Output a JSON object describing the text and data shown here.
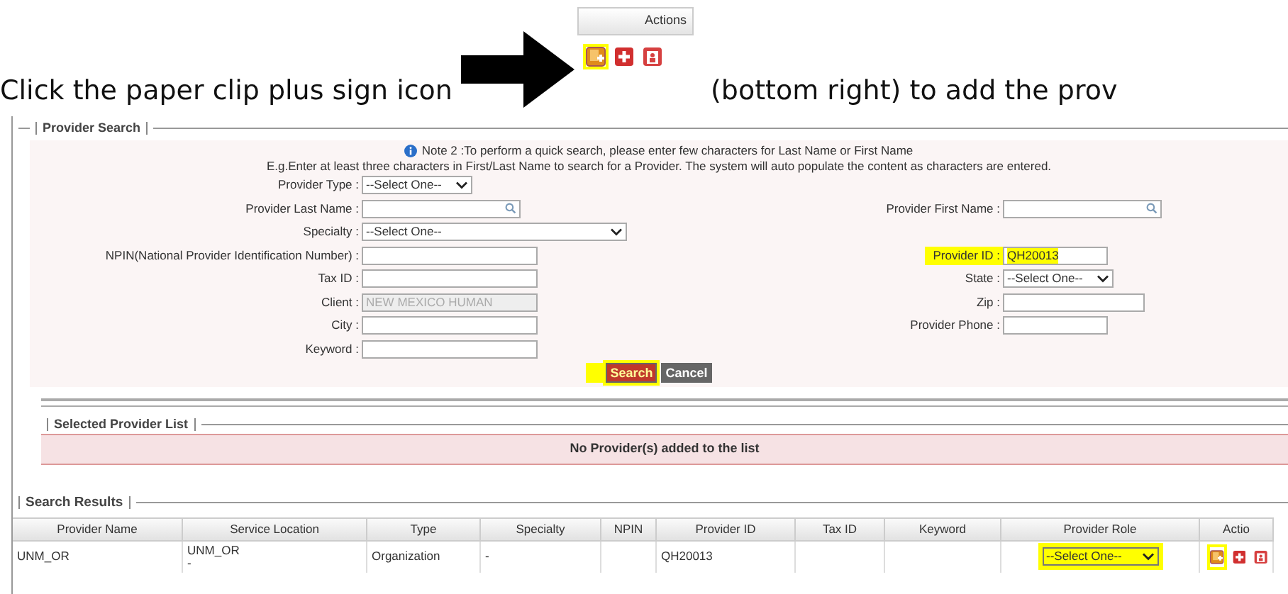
{
  "instruction": {
    "before": "Click the paper clip plus sign icon",
    "inset_header": "Actions",
    "after": "(bottom right) to add the prov"
  },
  "provider_search": {
    "title": "Provider Search",
    "note": "Note 2 :To perform a quick search, please enter few characters for Last Name or First Name",
    "example": "E.g.Enter at least three characters in First/Last Name to search for a Provider. The system will auto populate the content as characters are entered.",
    "rows": [
      {
        "left": {
          "label": "Provider Type :",
          "kind": "select",
          "value": "--Select One--",
          "highlighted": false,
          "disabled": false
        }
      },
      {
        "left": {
          "label": "Provider Last Name :",
          "kind": "lookup",
          "highlighted": false,
          "disabled": false
        },
        "right": {
          "label": "Provider First Name :",
          "kind": "lookup",
          "highlighted": false,
          "disabled": false
        }
      },
      {
        "left": {
          "label": "Specialty :",
          "kind": "wide-select",
          "value": "--Select One--",
          "highlighted": false,
          "disabled": false
        }
      },
      {
        "left": {
          "label": "NPIN(National Provider Identification Number) :",
          "kind": "text",
          "highlighted": false,
          "disabled": false
        },
        "right": {
          "label": "Provider ID :",
          "kind": "text",
          "value": "QH20013",
          "highlighted": true,
          "disabled": false
        }
      },
      {
        "left": {
          "label": "Tax ID :",
          "kind": "text",
          "highlighted": false,
          "disabled": false
        },
        "right": {
          "label": "State :",
          "kind": "select",
          "value": "--Select One--",
          "highlighted": false,
          "disabled": false
        }
      },
      {
        "left": {
          "label": "Client :",
          "kind": "text",
          "value": "NEW MEXICO HUMAN",
          "highlighted": false,
          "disabled": true
        },
        "right": {
          "label": "Zip :",
          "kind": "text",
          "highlighted": false,
          "disabled": false
        }
      },
      {
        "left": {
          "label": "City :",
          "kind": "text",
          "highlighted": false,
          "disabled": false
        },
        "right": {
          "label": "Provider Phone :",
          "kind": "text",
          "highlighted": false,
          "disabled": false
        }
      },
      {
        "left": {
          "label": "Keyword :",
          "kind": "text",
          "highlighted": false,
          "disabled": false
        }
      }
    ],
    "buttons": [
      {
        "label": "Search",
        "kind": "primary",
        "highlighted": true
      },
      {
        "label": "Cancel",
        "kind": "secondary",
        "highlighted": false
      }
    ]
  },
  "selected_provider_list": {
    "title": "Selected Provider List",
    "message": "No Provider(s) added to the list"
  },
  "search_results": {
    "title": "Search Results",
    "columns": [
      "Provider Name",
      "Service Location",
      "Type",
      "Specialty",
      "NPIN",
      "Provider ID",
      "Tax ID",
      "Keyword",
      "Provider Role",
      "Actio"
    ],
    "rows": [
      {
        "cells": [
          "UNM_OR",
          [
            "UNM_OR",
            "-"
          ],
          "Organization",
          "-",
          "",
          "QH20013",
          "",
          ""
        ],
        "role": {
          "value": "--Select One--",
          "highlighted": true
        }
      }
    ]
  }
}
